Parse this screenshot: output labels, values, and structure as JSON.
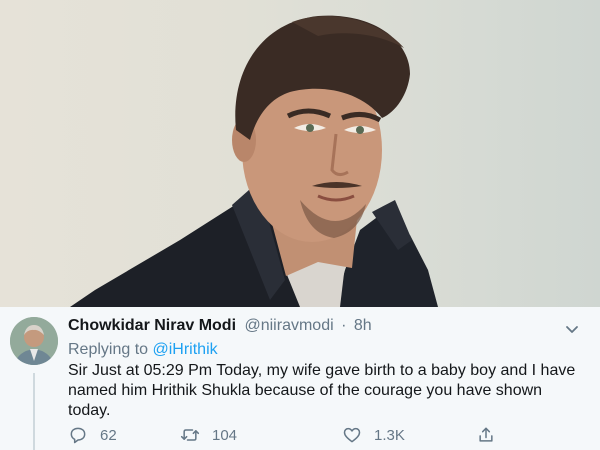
{
  "tweet": {
    "display_name": "Chowkidar Nirav Modi",
    "handle": "@niiravmodi",
    "separator": "·",
    "time": "8h",
    "reply_prefix": "Replying to",
    "reply_mention": "@iHrithik",
    "text": "Sir Just at 05:29 Pm Today, my wife gave birth to a baby boy and I have named him Hrithik Shukla because of the courage you have shown today.",
    "actions": {
      "replies": "62",
      "retweets": "104",
      "likes": "1.3K"
    }
  },
  "icons": {
    "reply": "speech-bubble-icon",
    "retweet": "retweet-icon",
    "like": "heart-icon",
    "share": "share-icon",
    "menu": "chevron-down-icon"
  },
  "colors": {
    "accent": "#1da1f2",
    "muted": "#657786",
    "text": "#14171a",
    "tweet_bg": "#f5f8fa"
  }
}
